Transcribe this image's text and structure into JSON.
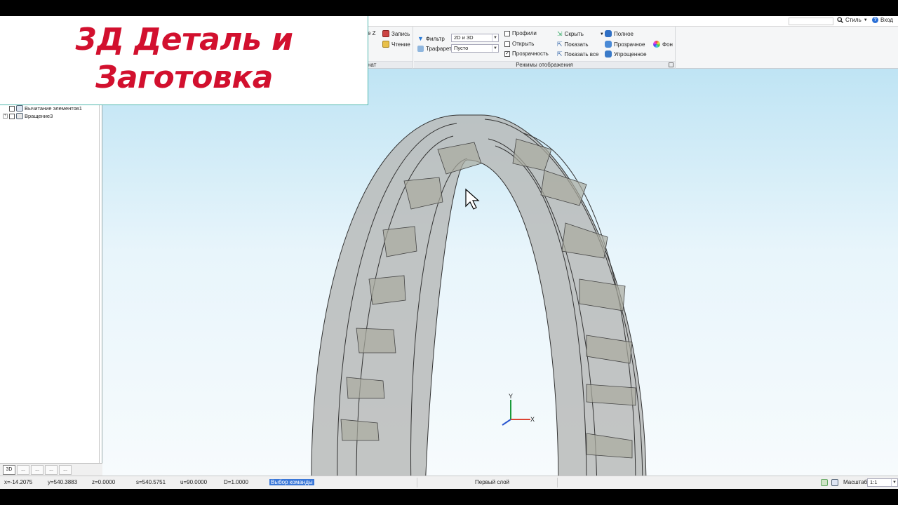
{
  "overlay": {
    "line1": "3Д Деталь и",
    "line2": "Заготовка"
  },
  "topbar": {
    "style_label": "Стиль",
    "login_label": "Вход"
  },
  "ribbon": {
    "partial_group_label": "нат",
    "partial_z": "е Z",
    "record_label": "Запись",
    "read_label": "Чтение",
    "filter_label": "Фильтр",
    "filter_value": "2D и 3D",
    "stencil_label": "Трафарет",
    "stencil_value": "Пусто",
    "profiles_label": "Профили",
    "open_label": "Открыть",
    "transparency_label": "Прозрачность",
    "hide_label": "Скрыть",
    "show_label": "Показать",
    "show_all_label": "Показать все",
    "full_label": "Полное",
    "transparent_label": "Прозрачное",
    "simplified_label": "Упрощенное",
    "background_label": "Фон",
    "modes_group_label": "Режимы отображения",
    "transparency_checked": true,
    "profiles_checked": false,
    "open_checked": false
  },
  "tree": {
    "items": [
      {
        "label": "Вычитание элементов1"
      },
      {
        "label": "Вращение3"
      }
    ],
    "tabs": [
      "3D",
      "...",
      "...",
      "...",
      "..."
    ]
  },
  "axes": {
    "x": "X",
    "y": "Y"
  },
  "status": {
    "x": "x=-14.2075",
    "y": "y=540.3883",
    "z": "z=0.0000",
    "s": "s=540.5751",
    "u": "u=90.0000",
    "d": "D=1.0000",
    "command": "Выбор команды",
    "layer": "Первый слой",
    "scale_label": "Масштаб",
    "scale_value": "1:1"
  },
  "colors": {
    "accent_red": "#d2102e",
    "card_border": "#4fb7ad",
    "selection_blue": "#3b78d8",
    "viewport_top": "#bfe4f4"
  }
}
